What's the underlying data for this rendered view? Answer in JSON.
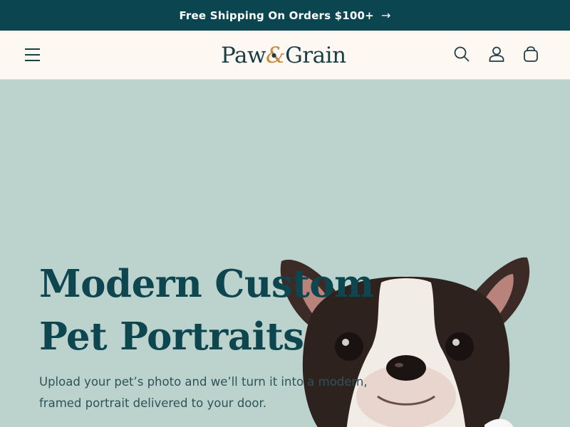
{
  "announcement": {
    "text": "Free Shipping On Orders $100+",
    "arrow": "→"
  },
  "header": {
    "logo_left": "Paw",
    "logo_amp": "&",
    "logo_right": "Grain",
    "icons": [
      "menu-icon",
      "search-icon",
      "account-icon",
      "cart-icon"
    ]
  },
  "hero": {
    "headline": "Modern Custom Pet Portraits",
    "subtext": "Upload your pet’s photo and we’ll turn it into a modern, framed portrait delivered to your door.",
    "image": "boston-terrier-photo"
  },
  "colors": {
    "announcement_bg": "#0b4550",
    "header_bg": "#fef8f2",
    "hero_bg": "#bcd3cd",
    "headline": "#0e4650",
    "logo_accent": "#c98a3f"
  }
}
